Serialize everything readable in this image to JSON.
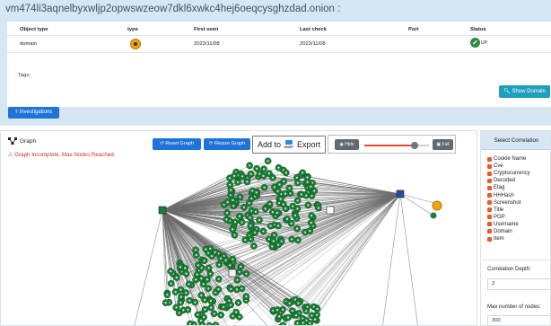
{
  "domain": {
    "title": "vm474li3aqnelbyxwljp2opwswzeow7dkl6xwkc4hej6oeqcysghzdad.onion :",
    "columns": [
      "Object type",
      "type",
      "First seen",
      "Last check",
      "Port",
      "Status"
    ],
    "row": {
      "object_type": "domain",
      "type_icon": "onion-icon",
      "first_seen": "2023/11/08",
      "last_check": "2023/11/08",
      "port": "",
      "status": "UP"
    },
    "tags_label": "Tags:",
    "show_domain_label": "Show Domain",
    "investigations_label": "Investigations"
  },
  "graph": {
    "title": "Graph",
    "warning": "Graph Incomplete, Max Nodes Reached.",
    "reset_label": "Reset Graph",
    "resize_label": "Resize Graph",
    "add_to_label": "Add to",
    "misp_logo_text": "MISP",
    "export_label": "Export",
    "hide_label": "Hide",
    "full_label": "Full",
    "slider_level": 0.78
  },
  "correlation": {
    "header": "Select Correlation",
    "items": [
      {
        "label": "Cookie Name",
        "checked": true
      },
      {
        "label": "Cve",
        "checked": true
      },
      {
        "label": "Cryptocurrency",
        "checked": true
      },
      {
        "label": "Decoded",
        "checked": true
      },
      {
        "label": "Etag",
        "checked": true
      },
      {
        "label": "HHHash",
        "checked": true
      },
      {
        "label": "Screenshot",
        "checked": true
      },
      {
        "label": "Title",
        "checked": true
      },
      {
        "label": "PGP",
        "checked": true
      },
      {
        "label": "Username",
        "checked": true
      },
      {
        "label": "Domain",
        "checked": true
      },
      {
        "label": "Item",
        "checked": true
      }
    ],
    "depth_label": "Correlation Depth:",
    "depth_value": "2",
    "max_nodes_label": "Max number of nodes:",
    "max_nodes_value": "300"
  },
  "colors": {
    "header_bg": "#d6e7f3",
    "primary": "#1e73d8",
    "info": "#1f9fbd",
    "success": "#2e8b3e",
    "danger": "#d62d2d",
    "onion": "#f2a50f",
    "node": "#1b7f36",
    "edge": "#6b6b6b"
  }
}
